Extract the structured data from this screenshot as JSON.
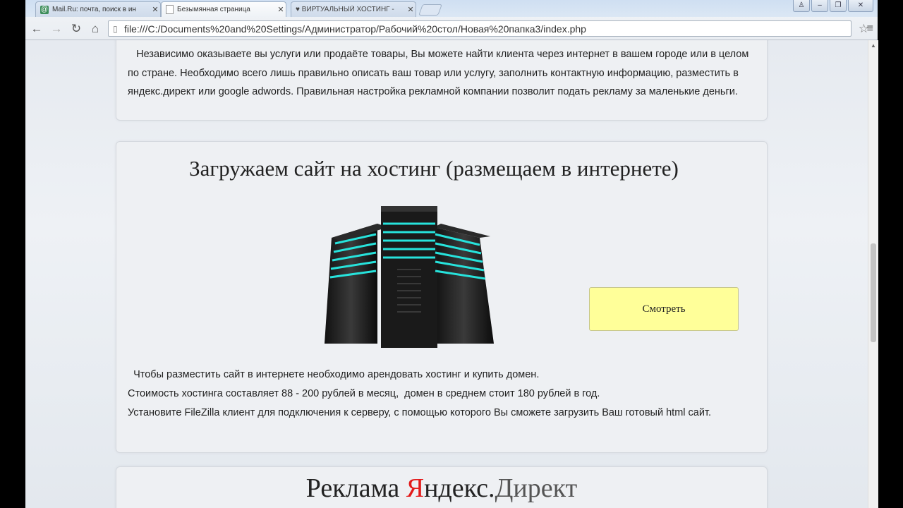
{
  "browser": {
    "tabs": [
      {
        "label": "Mail.Ru: почта, поиск в ин",
        "icon": "mailru-icon"
      },
      {
        "label": "Безымянная страница",
        "icon": "page-icon"
      },
      {
        "label": "♥ ВИРТУАЛЬНЫЙ ХОСТИНГ -",
        "icon": "heart-icon"
      }
    ],
    "url": "file:///C:/Documents%20and%20Settings/Администратор/Рабочий%20стол/Новая%20папка3/index.php"
  },
  "section1": {
    "text": "   Независимо оказываете вы услуги или продаёте товары, Вы можете найти клиента через интернет в вашем городе или в целом по стране. Необходимо всего лишь правильно описать ваш товар или услугу, заполнить контактную информацию, разместить в яндекс.директ или google adwords. Правильная настройка рекламной компании позволит подать рекламу за маленькие деньги."
  },
  "section2": {
    "title": "Загружаем сайт на хостинг (размещаем в интернете)",
    "button": "Смотреть",
    "lines": [
      "  Чтобы разместить сайт в интернете необходимо арендовать хостинг и купить домен.",
      "Стоимость хостинга составляет 88 - 200 рублей в месяц,  домен в среднем стоит 180 рублей в год.",
      "Установите FileZilla клиент для подключения к серверу, с помощью которого Вы сможете загрузить Ваш готовый html сайт."
    ]
  },
  "section3": {
    "title_part1": "Реклама ",
    "title_part2": "Я",
    "title_part3": "ндекс.",
    "title_part4": "Директ"
  },
  "colors": {
    "accent_button": "#ffff99",
    "yandex_red": "#e31a1a"
  }
}
